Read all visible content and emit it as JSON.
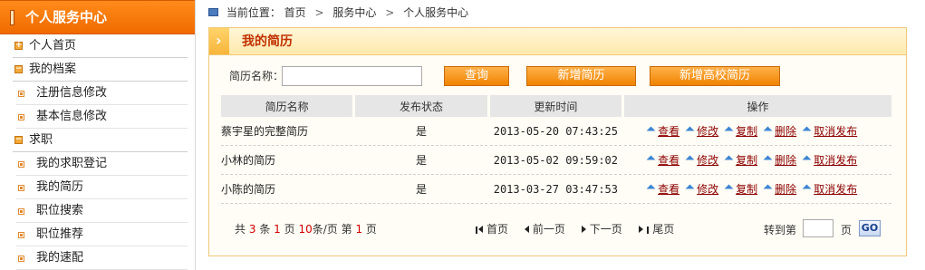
{
  "sidebar": {
    "title": "个人服务中心",
    "items": [
      {
        "type": "top",
        "label": "个人首页",
        "icon": "plus-square-icon"
      },
      {
        "type": "top",
        "label": "我的档案",
        "icon": "minus-square-icon"
      },
      {
        "type": "sub",
        "label": "注册信息修改"
      },
      {
        "type": "sub",
        "label": "基本信息修改"
      },
      {
        "type": "top",
        "label": "求职",
        "icon": "minus-square-icon"
      },
      {
        "type": "sub",
        "label": "我的求职登记"
      },
      {
        "type": "sub",
        "label": "我的简历"
      },
      {
        "type": "sub",
        "label": "职位搜索"
      },
      {
        "type": "sub",
        "label": "职位推荐"
      },
      {
        "type": "sub",
        "label": "我的速配"
      }
    ]
  },
  "breadcrumb": {
    "prefix": "当前位置：",
    "home": "首页",
    "section": "服务中心",
    "current": "个人服务中心",
    "separator": ">"
  },
  "panel": {
    "title": "我的简历"
  },
  "search": {
    "label": "简历名称：",
    "value": "",
    "placeholder": ""
  },
  "buttons": {
    "query": "查询",
    "new_resume": "新增简历",
    "new_school_resume": "新增高校简历"
  },
  "table": {
    "headers": [
      "简历名称",
      "发布状态",
      "更新时间",
      "操作"
    ],
    "rows": [
      {
        "name": "蔡宇星的完整简历",
        "status": "是",
        "updated": "2013-05-20 07:43:25"
      },
      {
        "name": "小林的简历",
        "status": "是",
        "updated": "2013-05-02 09:59:02"
      },
      {
        "name": "小陈的简历",
        "status": "是",
        "updated": "2013-03-27 03:47:53"
      }
    ],
    "ops": [
      "查看",
      "修改",
      "复制",
      "删除",
      "取消发布"
    ]
  },
  "pager": {
    "text_total": "共",
    "total": "3",
    "text_items": "条",
    "page_count": "1",
    "text_page": "页",
    "per_page": "10",
    "text_per_page": "条/页 第",
    "current": "1",
    "text_page_end": "页",
    "first": "首页",
    "prev": "前一页",
    "next": "下一页",
    "last": "尾页",
    "goto_label": "转到第",
    "goto_page_unit": "页",
    "go": "GO"
  },
  "colors": {
    "accent": "#f07a00",
    "link": "#8b0000",
    "count": "#d40000"
  }
}
